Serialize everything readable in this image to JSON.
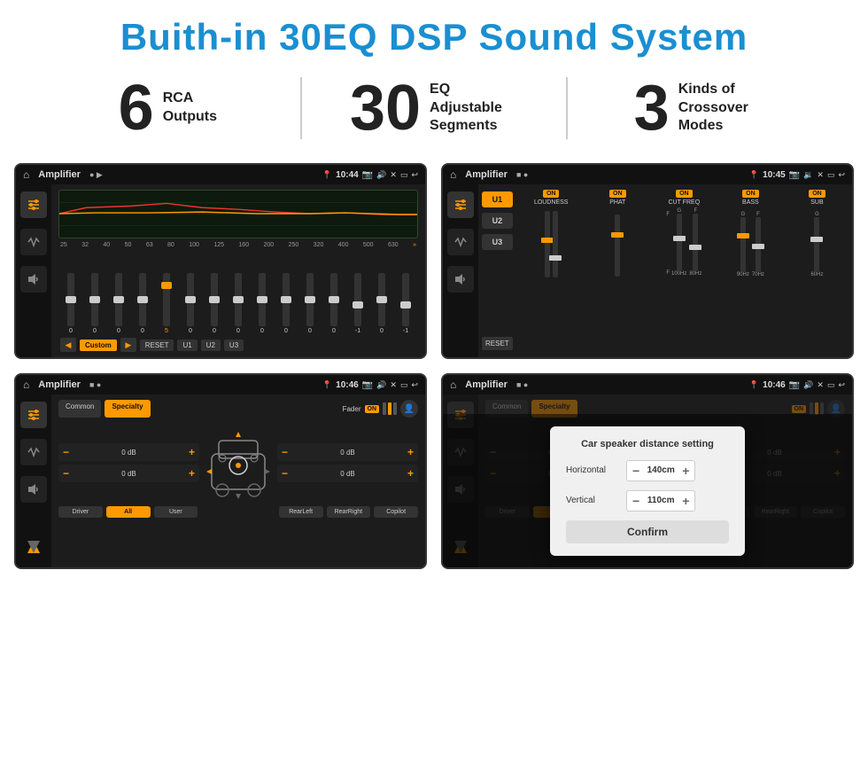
{
  "header": {
    "title": "Buith-in 30EQ DSP Sound System"
  },
  "stats": [
    {
      "number": "6",
      "label_line1": "RCA",
      "label_line2": "Outputs"
    },
    {
      "number": "30",
      "label_line1": "EQ Adjustable",
      "label_line2": "Segments"
    },
    {
      "number": "3",
      "label_line1": "Kinds of",
      "label_line2": "Crossover Modes"
    }
  ],
  "screens": [
    {
      "id": "screen1",
      "statusbar": {
        "title": "Amplifier",
        "time": "10:44"
      },
      "type": "eq"
    },
    {
      "id": "screen2",
      "statusbar": {
        "title": "Amplifier",
        "time": "10:45"
      },
      "type": "crossover"
    },
    {
      "id": "screen3",
      "statusbar": {
        "title": "Amplifier",
        "time": "10:46"
      },
      "type": "fader"
    },
    {
      "id": "screen4",
      "statusbar": {
        "title": "Amplifier",
        "time": "10:46"
      },
      "type": "fader-dialog"
    }
  ],
  "eq": {
    "freqs": [
      "25",
      "32",
      "40",
      "50",
      "63",
      "80",
      "100",
      "125",
      "160",
      "200",
      "250",
      "320",
      "400",
      "500",
      "630"
    ],
    "values": [
      "0",
      "0",
      "0",
      "0",
      "5",
      "0",
      "0",
      "0",
      "0",
      "0",
      "0",
      "0",
      "-1",
      "0",
      "-1"
    ],
    "preset": "Custom",
    "buttons": [
      "RESET",
      "U1",
      "U2",
      "U3"
    ]
  },
  "crossover": {
    "units": [
      "U1",
      "U2",
      "U3"
    ],
    "controls": [
      {
        "label": "LOUDNESS",
        "on": true
      },
      {
        "label": "PHAT",
        "on": true
      },
      {
        "label": "CUT FREQ",
        "on": true
      },
      {
        "label": "BASS",
        "on": true
      },
      {
        "label": "SUB",
        "on": true
      }
    ],
    "reset_label": "RESET"
  },
  "fader": {
    "tabs": [
      "Common",
      "Specialty"
    ],
    "active_tab": "Specialty",
    "fader_label": "Fader",
    "fader_on": "ON",
    "speaker_values": [
      "0 dB",
      "0 dB",
      "0 dB",
      "0 dB"
    ],
    "bottom_buttons": [
      "Driver",
      "RearLeft",
      "All",
      "User",
      "RearRight",
      "Copilot"
    ]
  },
  "dialog": {
    "title": "Car speaker distance setting",
    "horizontal_label": "Horizontal",
    "horizontal_value": "140cm",
    "vertical_label": "Vertical",
    "vertical_value": "110cm",
    "confirm_label": "Confirm"
  }
}
